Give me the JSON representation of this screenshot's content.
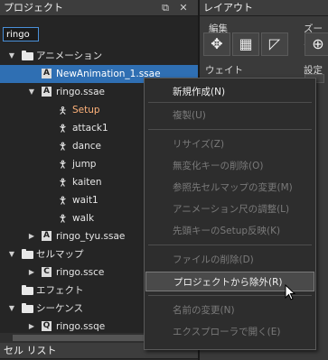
{
  "left_panel": {
    "title": "プロジェクト",
    "search_value": "ringo",
    "tree": [
      {
        "label": "アニメーション",
        "icon": "folder-icon",
        "arrow": "▼"
      },
      {
        "label": "NewAnimation_1.ssae",
        "icon": "animation-file-icon",
        "arrow": "",
        "selected": true
      },
      {
        "label": "ringo.ssae",
        "icon": "animation-file-icon",
        "arrow": "▼"
      },
      {
        "label": "Setup",
        "icon": "figure-icon",
        "arrow": "",
        "highlight": true
      },
      {
        "label": "attack1",
        "icon": "running-figure-icon",
        "arrow": ""
      },
      {
        "label": "dance",
        "icon": "running-figure-icon",
        "arrow": ""
      },
      {
        "label": "jump",
        "icon": "running-figure-icon",
        "arrow": ""
      },
      {
        "label": "kaiten",
        "icon": "running-figure-icon",
        "arrow": ""
      },
      {
        "label": "wait1",
        "icon": "running-figure-icon",
        "arrow": ""
      },
      {
        "label": "walk",
        "icon": "running-figure-icon",
        "arrow": ""
      },
      {
        "label": "ringo_tyu.ssae",
        "icon": "animation-file-icon",
        "arrow": "▶"
      },
      {
        "label": "セルマップ",
        "icon": "folder-icon",
        "arrow": "▼"
      },
      {
        "label": "ringo.ssce",
        "icon": "cellmap-file-icon",
        "arrow": "▶"
      },
      {
        "label": "エフェクト",
        "icon": "folder-icon",
        "arrow": ""
      },
      {
        "label": "シーケンス",
        "icon": "folder-icon",
        "arrow": "▼"
      },
      {
        "label": "ringo.ssqe",
        "icon": "sequence-file-icon",
        "arrow": "▶"
      }
    ],
    "file_letters": {
      "animation": "A",
      "cellmap": "C",
      "sequence": "Q"
    }
  },
  "bottom_panel": {
    "title": "セル リスト"
  },
  "right_panel": {
    "title": "レイアウト",
    "group_edit": "編集",
    "group_zoom": "ズーム",
    "group_weight": "ウェイト",
    "group_settings": "設定"
  },
  "context_menu": {
    "items": [
      {
        "label": "新規作成(N)",
        "enabled": true
      },
      {
        "label": "複製(U)",
        "enabled": false
      },
      {
        "label": "リサイズ(Z)",
        "enabled": false
      },
      {
        "label": "無変化キーの削除(O)",
        "enabled": false
      },
      {
        "label": "参照先セルマップの変更(M)",
        "enabled": false
      },
      {
        "label": "アニメーション尺の調整(L)",
        "enabled": false
      },
      {
        "label": "先頭キーのSetup反映(K)",
        "enabled": false
      },
      {
        "label": "ファイルの削除(D)",
        "enabled": false
      },
      {
        "label": "プロジェクトから除外(R)",
        "enabled": true,
        "hover": true
      },
      {
        "label": "名前の変更(N)",
        "enabled": false
      },
      {
        "label": "エクスプローラで開く(E)",
        "enabled": false
      }
    ]
  },
  "colors": {
    "selection": "#2f6fb3",
    "accent": "#4a90d9",
    "setup_text": "#ffb27a"
  }
}
